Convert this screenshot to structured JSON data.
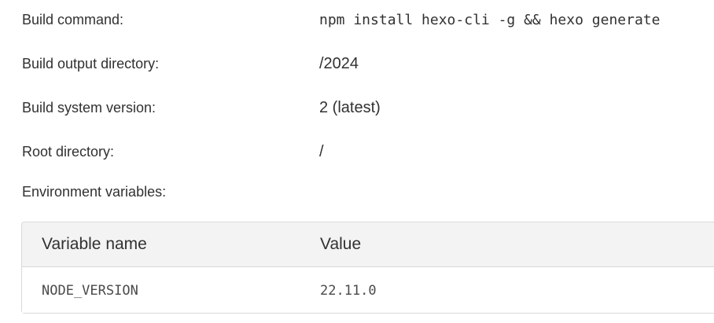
{
  "settings": [
    {
      "label": "Build command:",
      "value": "npm install hexo-cli -g && hexo generate",
      "mono": true
    },
    {
      "label": "Build output directory:",
      "value": "/2024",
      "mono": false
    },
    {
      "label": "Build system version:",
      "value": "2 (latest)",
      "mono": false
    },
    {
      "label": "Root directory:",
      "value": "/",
      "mono": false
    }
  ],
  "env": {
    "title": "Environment variables:",
    "headers": {
      "name": "Variable name",
      "value": "Value"
    },
    "rows": [
      {
        "name": "NODE_VERSION",
        "value": "22.11.0"
      }
    ]
  }
}
